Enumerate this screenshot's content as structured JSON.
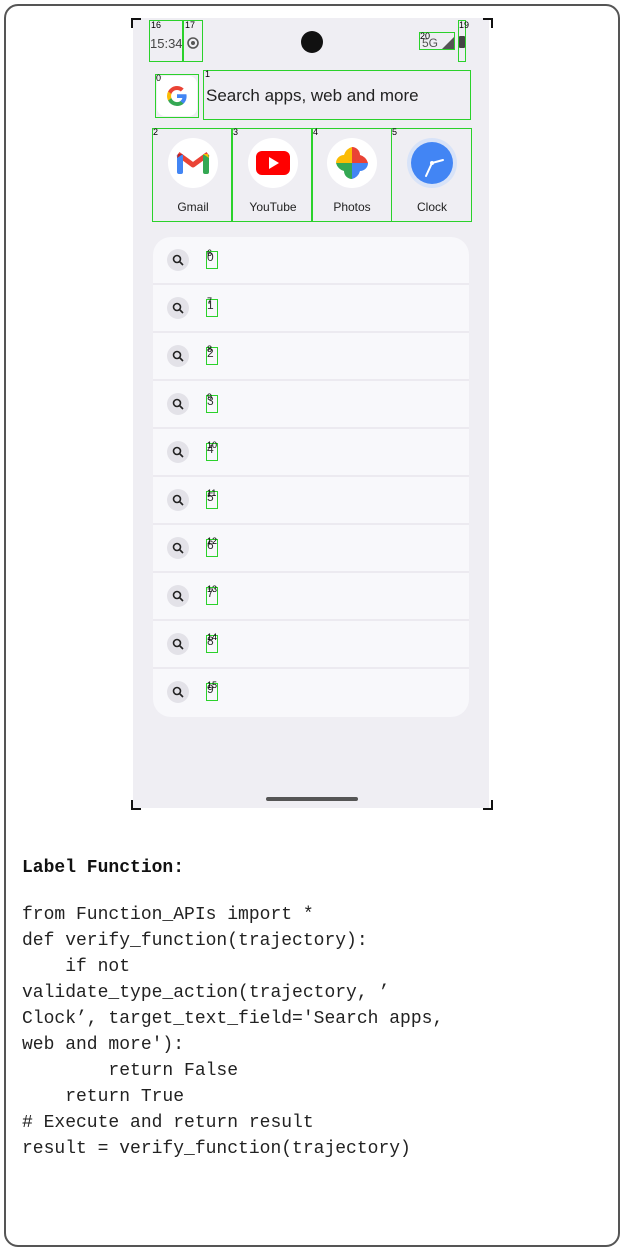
{
  "status_bar": {
    "time": "15:34",
    "network": "5G"
  },
  "search": {
    "placeholder": "Search apps, web and more"
  },
  "apps": [
    {
      "name": "Gmail"
    },
    {
      "name": "YouTube"
    },
    {
      "name": "Photos"
    },
    {
      "name": "Clock"
    }
  ],
  "suggestions": [
    "0",
    "1",
    "2",
    "3",
    "4",
    "5",
    "6",
    "7",
    "8",
    "9"
  ],
  "overlay_labels": [
    "0",
    "1",
    "2",
    "3",
    "4",
    "5",
    "6",
    "7",
    "8",
    "9",
    "10",
    "11",
    "12",
    "13",
    "14",
    "15",
    "16",
    "17",
    "19",
    "20"
  ],
  "code": {
    "title": "Label Function:",
    "text": "from Function_APIs import *\ndef verify_function(trajectory):\n    if not\nvalidate_type_action(trajectory, ’\nClock’, target_text_field='Search apps,\nweb and more'):\n        return False\n    return True\n# Execute and return result\nresult = verify_function(trajectory)"
  },
  "colors": {
    "overlay": "#2bd12b",
    "phone_bg": "#efeef3",
    "clock_blue": "#4285f4"
  }
}
